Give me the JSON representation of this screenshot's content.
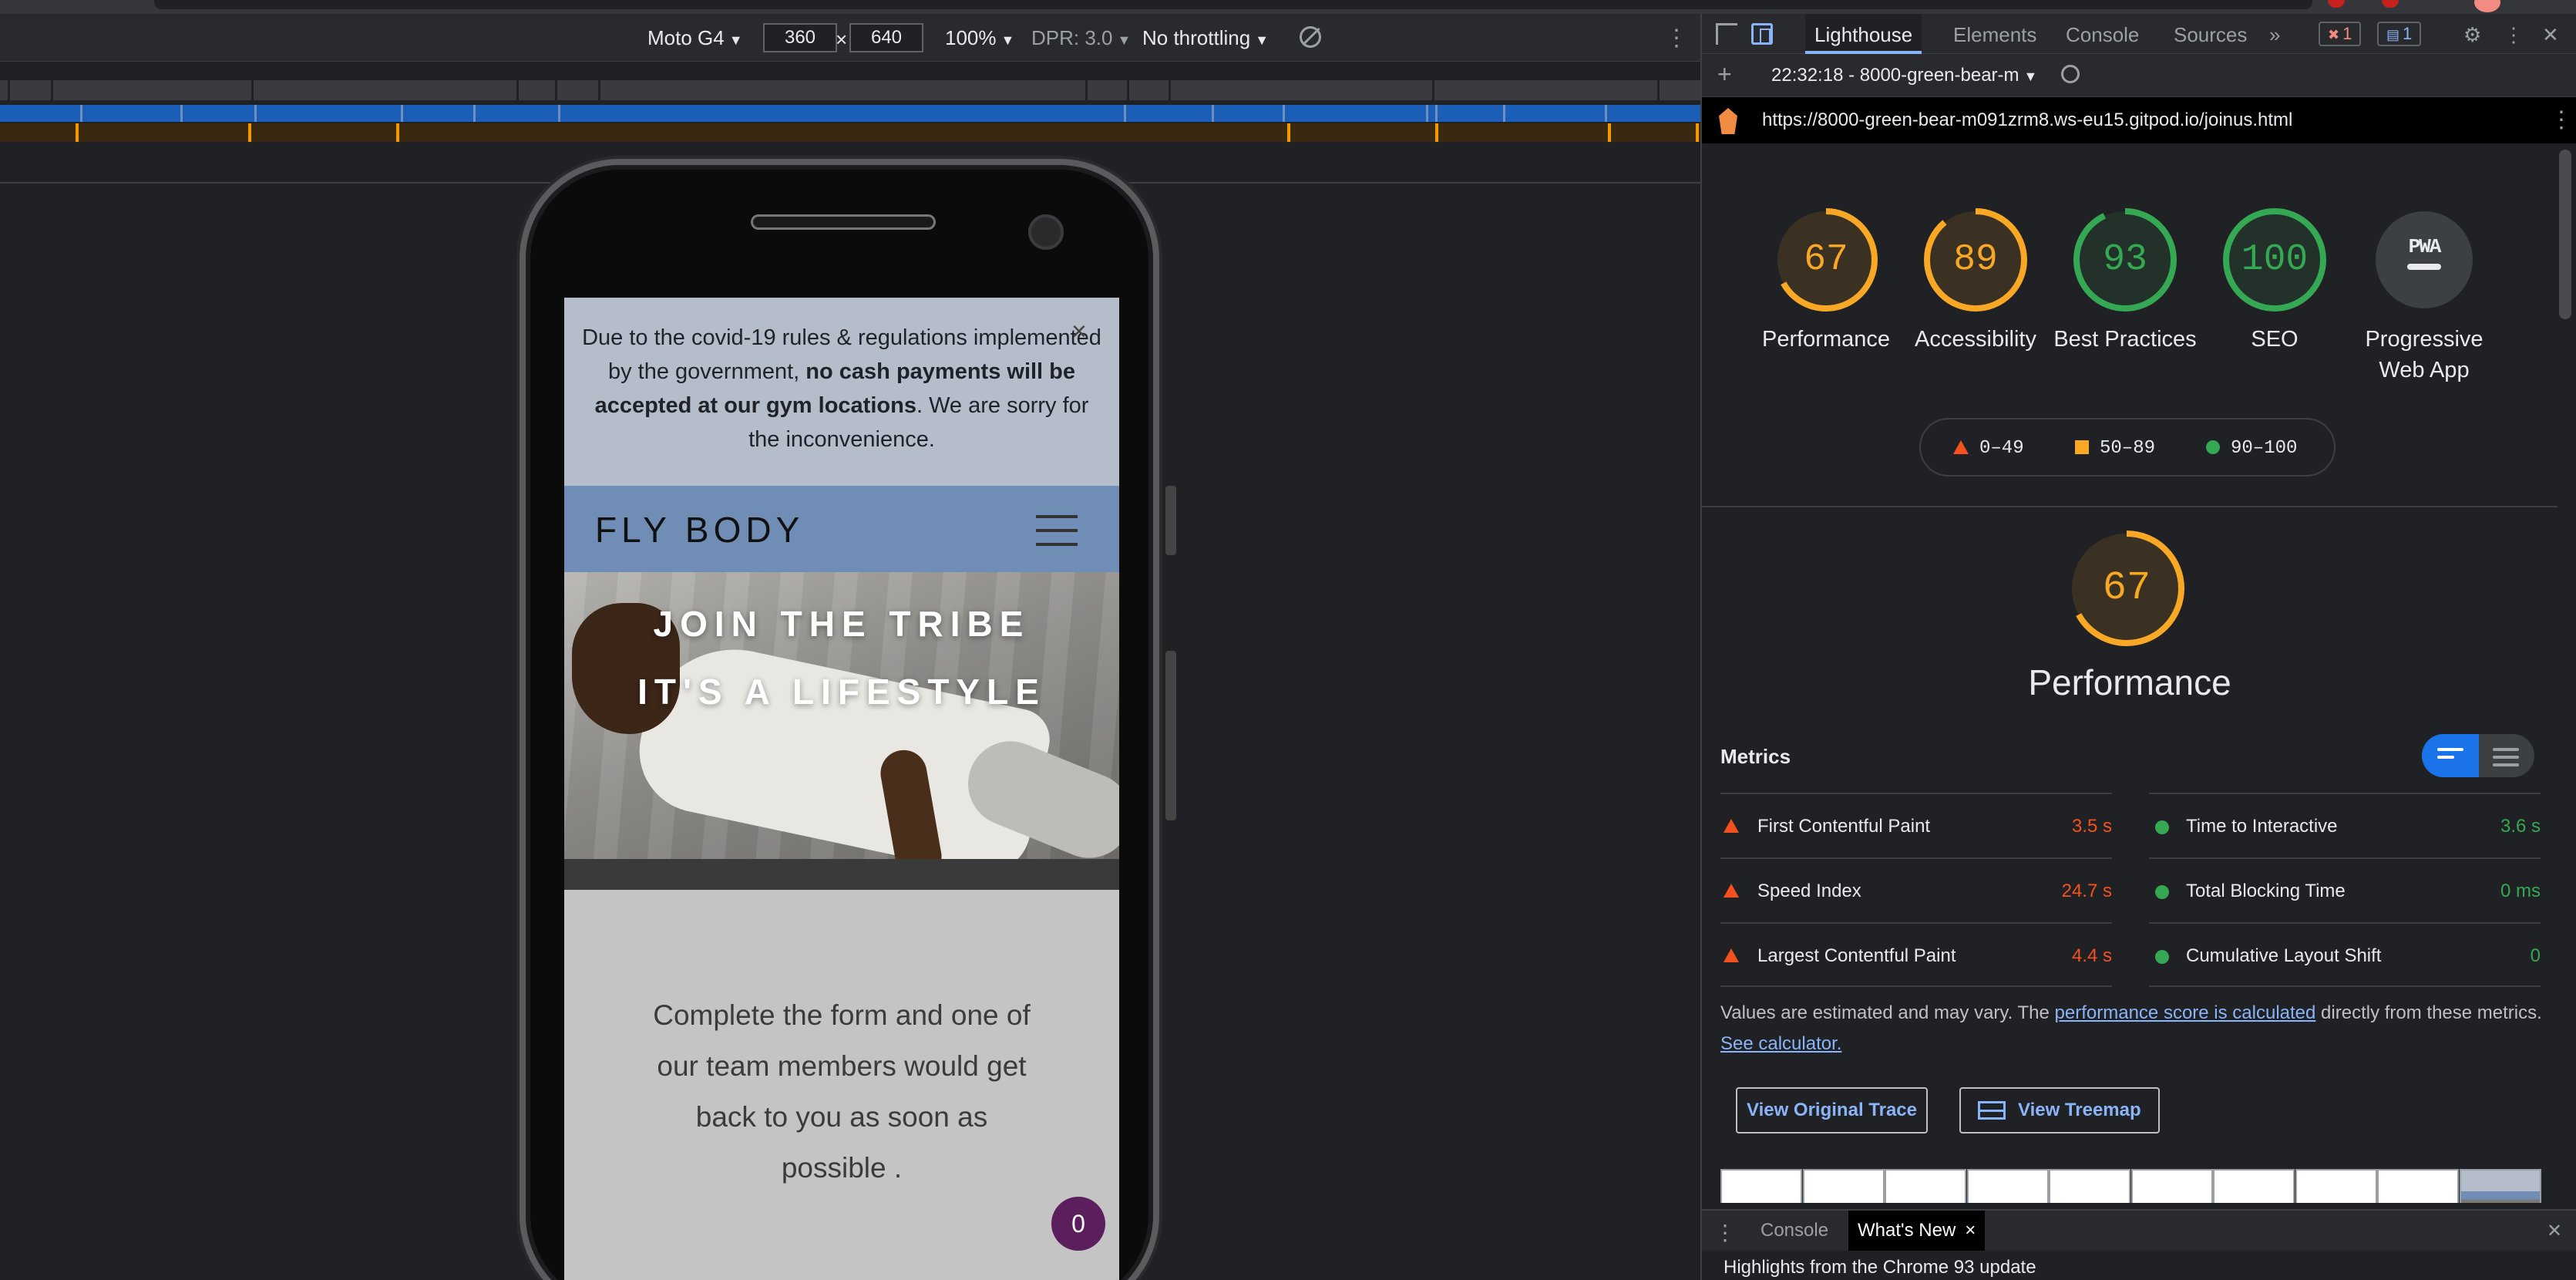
{
  "device_toolbar": {
    "device": "Moto G4",
    "width": "360",
    "times": "×",
    "height": "640",
    "zoom": "100%",
    "dpr": "DPR: 3.0",
    "throttling": "No throttling",
    "more": "⋮"
  },
  "site": {
    "banner_part1": "Due to the covid-19 rules & regulations implemented by the government, ",
    "banner_bold1": "no cash payments will be accepted at our gym locations",
    "banner_part2": ". We are sorry for the inconvenience.",
    "banner_close": "×",
    "brand": "FLY BODY",
    "hero_line1": "JOIN THE TRIBE",
    "hero_line2": "IT'S A LIFESTYLE",
    "form_intro": "Complete the form and one of our team members would get back to you as soon as possible .",
    "chat_count": "0"
  },
  "devtools": {
    "tabs": [
      "Lighthouse",
      "Elements",
      "Console",
      "Sources"
    ],
    "more_tabs": "»",
    "error_count": "1",
    "message_count": "1",
    "settings": "⚙",
    "menu": "⋮",
    "close": "✕"
  },
  "lighthouse": {
    "add": "+",
    "report_select": "22:32:18 - 8000-green-bear-m",
    "url": "https://8000-green-bear-m091zrm8.ws-eu15.gitpod.io/joinus.html",
    "url_menu": "⋮",
    "gauges": [
      {
        "label": "Performance",
        "score": "67",
        "value": 67,
        "status": "average"
      },
      {
        "label": "Accessibility",
        "score": "89",
        "value": 89,
        "status": "average"
      },
      {
        "label": "Best Practices",
        "score": "93",
        "value": 93,
        "status": "pass"
      },
      {
        "label": "SEO",
        "score": "100",
        "value": 100,
        "status": "pass"
      },
      {
        "label": "Progressive Web App",
        "score": "PWA",
        "value": null,
        "status": "na"
      }
    ],
    "legend": [
      {
        "range": "0–49",
        "shape": "triangle",
        "color": "#f4511e"
      },
      {
        "range": "50–89",
        "shape": "square",
        "color": "#f9a825"
      },
      {
        "range": "90–100",
        "shape": "circle",
        "color": "#34a853"
      }
    ],
    "performance": {
      "score": "67",
      "value": 67,
      "title": "Performance"
    },
    "metrics_header": "Metrics",
    "metrics_left": [
      {
        "label": "First Contentful Paint",
        "value": "3.5 s",
        "status": "fail"
      },
      {
        "label": "Speed Index",
        "value": "24.7 s",
        "status": "fail"
      },
      {
        "label": "Largest Contentful Paint",
        "value": "4.4 s",
        "status": "fail"
      }
    ],
    "metrics_right": [
      {
        "label": "Time to Interactive",
        "value": "3.6 s",
        "status": "pass"
      },
      {
        "label": "Total Blocking Time",
        "value": "0 ms",
        "status": "pass"
      },
      {
        "label": "Cumulative Layout Shift",
        "value": "0",
        "status": "pass"
      }
    ],
    "note_prefix": "Values are estimated and may vary. The ",
    "note_link": "performance score is calculated",
    "note_suffix": " directly from these metrics. ",
    "note_link2": "See calculator.",
    "btn_trace": "View Original Trace",
    "btn_treemap": "View Treemap",
    "colors": {
      "pass": "#34a853",
      "average": "#f9a825",
      "fail": "#f4511e"
    }
  },
  "drawer": {
    "menu": "⋮",
    "tabs": [
      "Console",
      "What's New"
    ],
    "tab_close": "×",
    "close": "✕",
    "body": "Highlights from the Chrome 93 update"
  }
}
